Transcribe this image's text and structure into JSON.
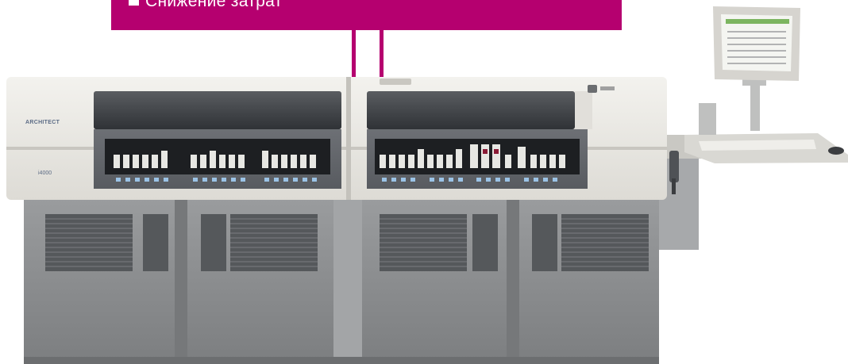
{
  "callout": {
    "text": "Снижение затрат"
  },
  "analyzer": {
    "brand": "ARCHITECT",
    "model": "i4000"
  },
  "colors": {
    "accent": "#b5006f",
    "cabinet": "#8d8f91",
    "upper_body": "#e9e7e2",
    "window": "#3f4246"
  }
}
